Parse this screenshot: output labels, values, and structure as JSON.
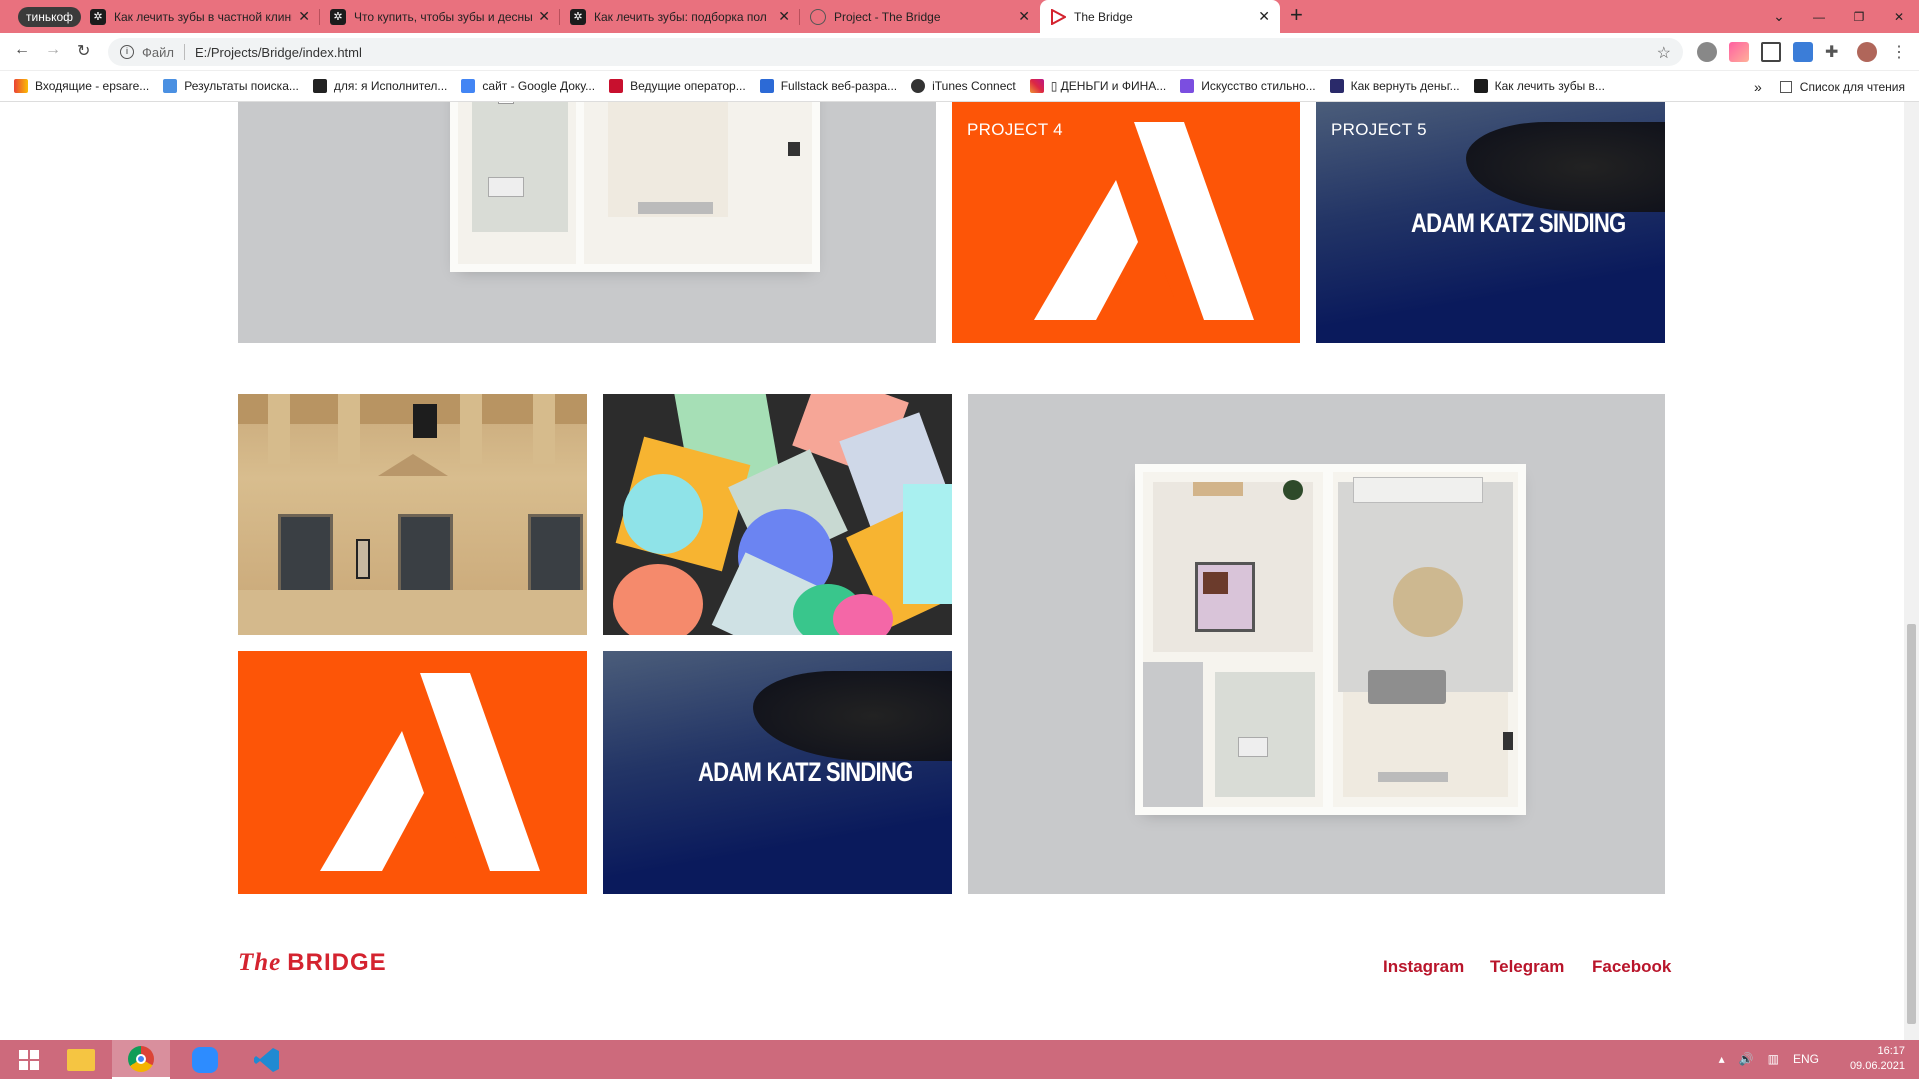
{
  "browser": {
    "tab_group_chip": "тинькоф",
    "tabs": [
      {
        "title": "Как лечить зубы в частной клини",
        "active": false
      },
      {
        "title": "Что купить, чтобы зубы и десны",
        "active": false
      },
      {
        "title": "Как лечить зубы: подборка пол",
        "active": false
      },
      {
        "title": "Project - The Bridge",
        "active": false
      },
      {
        "title": "The Bridge",
        "active": true
      }
    ],
    "address": {
      "scheme_label": "Файл",
      "url": "E:/Projects/Bridge/index.html"
    },
    "bookmarks": [
      {
        "label": "Входящие - epsare..."
      },
      {
        "label": "Результаты поиска..."
      },
      {
        "label": "для: я Исполнител..."
      },
      {
        "label": "сайт - Google Доку..."
      },
      {
        "label": "Ведущие оператор..."
      },
      {
        "label": "Fullstack веб-разра..."
      },
      {
        "label": "iTunes Connect"
      },
      {
        "label": "▯ ДЕНЬГИ и ФИНА..."
      },
      {
        "label": "Искусство стильно..."
      },
      {
        "label": "Как вернуть деньг..."
      },
      {
        "label": "Как лечить зубы в..."
      }
    ],
    "reading_list": "Список для чтения",
    "overflow_chevron": "»"
  },
  "page": {
    "projects": [
      {
        "label": "PROJECT 4"
      },
      {
        "label": "PROJECT 5"
      }
    ],
    "adam_katz_text": "ADAM KATZ SINDING",
    "footer": {
      "logo_script": "The",
      "logo_word": "BRIDGE",
      "links": [
        "Instagram",
        "Telegram",
        "Facebook"
      ]
    }
  },
  "taskbar": {
    "lang": "ENG",
    "time": "16:17",
    "date": "09.06.2021"
  },
  "colors": {
    "tab_strip": "#e9717e",
    "orange": "#fd5507",
    "navy": "#0a1a5c",
    "footer_red": "#d4232f",
    "taskbar": "#cd6a7c"
  }
}
